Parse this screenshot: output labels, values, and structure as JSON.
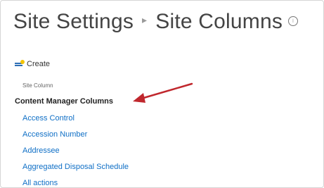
{
  "header": {
    "title_part1": "Site Settings",
    "separator": "▸",
    "title_part2": "Site Columns",
    "info_icon_glyph": "i"
  },
  "toolbar": {
    "create_label": "Create",
    "create_icon": "new-column-icon"
  },
  "table": {
    "column_header": "Site Column"
  },
  "group": {
    "title": "Content Manager Columns"
  },
  "columns": [
    "Access Control",
    "Accession Number",
    "Addressee",
    "Aggregated Disposal Schedule",
    "All actions"
  ],
  "colors": {
    "link": "#0f6fc6",
    "arrow": "#c0272d",
    "title": "#444444"
  }
}
